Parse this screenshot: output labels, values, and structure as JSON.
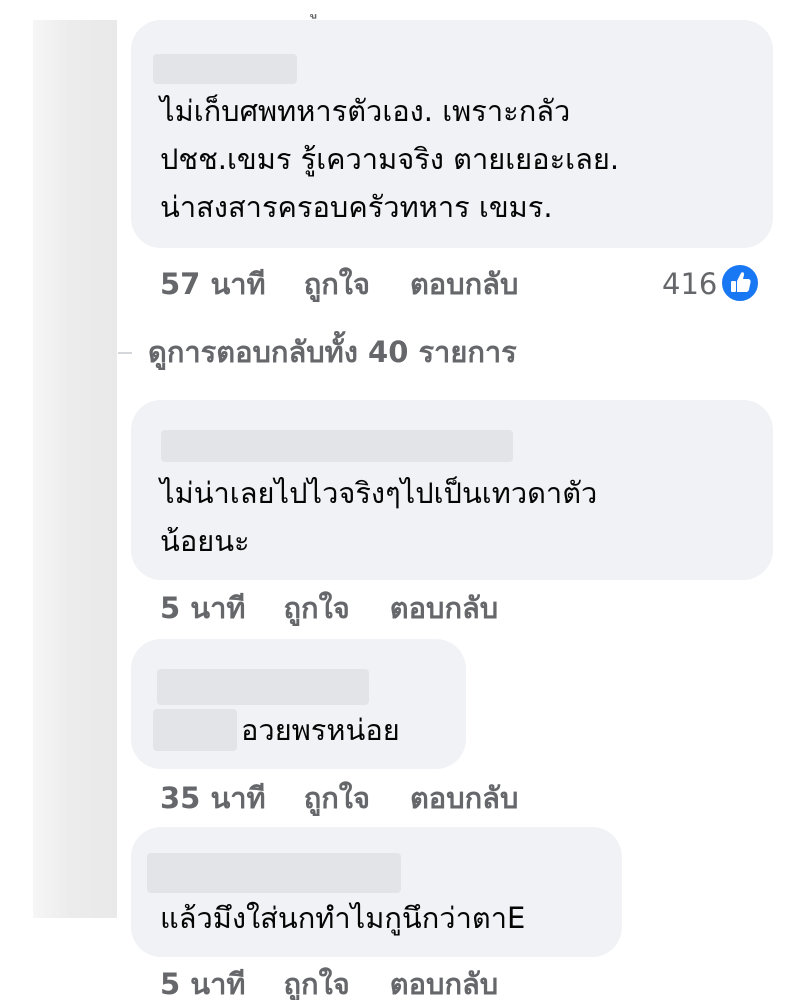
{
  "comments": [
    {
      "lines": [
        "ไม่เก็บศพทหารตัวเอง. เพราะกลัว",
        "ปชช.เขมร รู้เความจริง ตายเยอะเลย.",
        "น่าสงสารครอบครัวทหาร เขมร."
      ],
      "time": "57 นาที",
      "like_label": "ถูกใจ",
      "reply_label": "ตอบกลับ",
      "reaction_count": "416",
      "reaction_icon": "like-thumb-icon"
    },
    {
      "lines": [
        "ไม่น่าเลยไปไวจริงๆไปเป็นเทวดาตัว",
        "น้อยนะ"
      ],
      "time": "5 นาที",
      "like_label": "ถูกใจ",
      "reply_label": "ตอบกลับ"
    },
    {
      "lines": [
        "อวยพรหน่อย"
      ],
      "time": "35 นาที",
      "like_label": "ถูกใจ",
      "reply_label": "ตอบกลับ"
    },
    {
      "lines": [
        "แล้วมึงใส่นกทำไมกูนึกว่าตาE"
      ],
      "time": "5 นาที",
      "like_label": "ถูกใจ",
      "reply_label": "ตอบกลับ"
    }
  ],
  "view_replies_label": "ดูการตอบกลับทั้ง 40 รายการ",
  "colors": {
    "bubble": "#f0f2f5",
    "meta_text": "#65676b",
    "like_blue": "#1877f2"
  }
}
